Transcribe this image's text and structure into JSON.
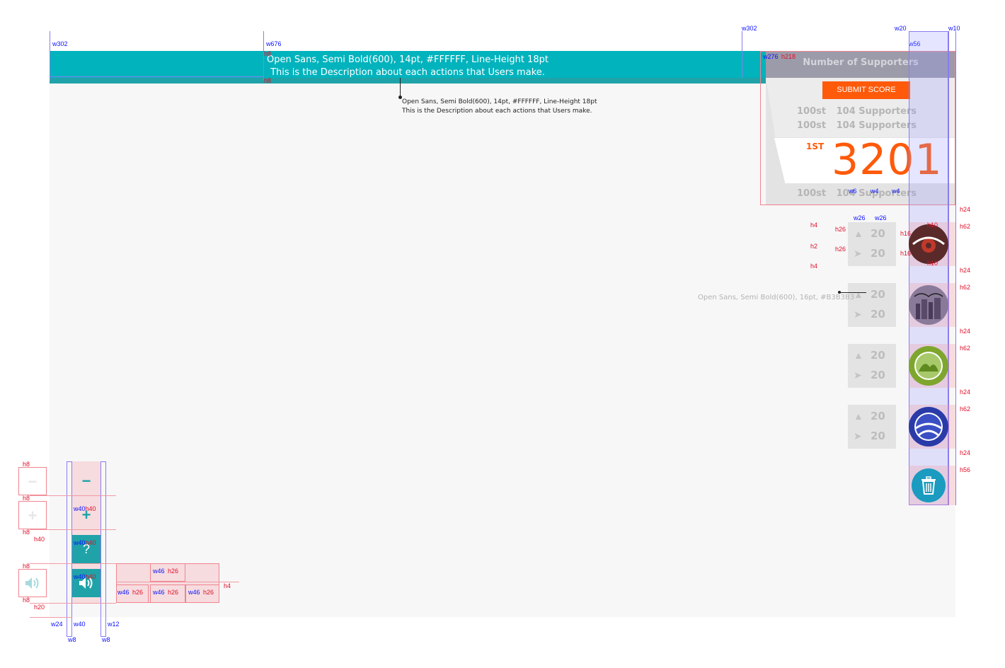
{
  "banner": {
    "line1": "Open Sans, Semi Bold(600), 14pt, #FFFFFF, Line-Height 18pt",
    "line2": "This is the Description about each actions that Users make."
  },
  "callout": {
    "line1": "Open Sans, Semi Bold(600), 14pt, #FFFFFF, Line-Height 18pt",
    "line2": "This is the Description about each actions that Users make."
  },
  "side_note": "Open Sans, Semi Bold(600), 16pt, #B3B3B3",
  "panel": {
    "title": "Number of Supporters",
    "submit_label": "SUBMIT SCORE",
    "rows": [
      {
        "rank": "100st",
        "supporters": "104 Supporters"
      },
      {
        "rank": "100st",
        "supporters": "104 Supporters"
      }
    ],
    "highlight": {
      "rank": "1ST",
      "score": "3201"
    },
    "bottom_row": {
      "rank": "100st",
      "supporters": "104 Supporters"
    }
  },
  "cards": [
    {
      "badge": "flower-badge-icon",
      "color": "#5a2a2a",
      "likes": "20",
      "shares": "20"
    },
    {
      "badge": "city-badge-icon",
      "color": "#8a7a9a",
      "likes": "20",
      "shares": "20"
    },
    {
      "badge": "camel-badge-icon",
      "color": "#7ea62e",
      "likes": "20",
      "shares": "20"
    },
    {
      "badge": "road-badge-icon",
      "color": "#2a3ba8",
      "likes": "20",
      "shares": "20"
    }
  ],
  "trash": {
    "icon": "trash-icon",
    "color": "#1a9bbf"
  },
  "controls": {
    "minus": "−",
    "plus": "+",
    "help": "?",
    "sound_icon": "speaker-icon"
  },
  "measures": {
    "top_blue": [
      "w302",
      "w676",
      "w302",
      "w20",
      "w10",
      "w56",
      "w276"
    ],
    "panel_red": "h218",
    "row_blue": [
      "w6",
      "w4",
      "w4",
      "w26",
      "w26"
    ],
    "row_red_left": [
      "h4",
      "h26",
      "h2",
      "h26",
      "h4"
    ],
    "row_red_mid": [
      "h10",
      "h16",
      "h16",
      "h10"
    ],
    "right_red": [
      "h24",
      "h62",
      "h24",
      "h62",
      "h24",
      "h62",
      "h24",
      "h62",
      "h24",
      "h56"
    ],
    "banner_red": [
      "h8",
      "h8"
    ],
    "ctl_red": [
      "h8",
      "h8",
      "h8",
      "h8",
      "h8",
      "h40",
      "h20"
    ],
    "ctl_box": [
      "w40",
      "h40"
    ],
    "ctl_bottom_blue": [
      "w24",
      "w40",
      "w12",
      "w8",
      "w8"
    ],
    "grid_blue": "w46",
    "grid_red": "h26",
    "grid_h4": "h4"
  },
  "colors": {
    "teal": "#00B3BD",
    "orange": "#FF5A0A",
    "gray_text": "#B3B3B3"
  }
}
